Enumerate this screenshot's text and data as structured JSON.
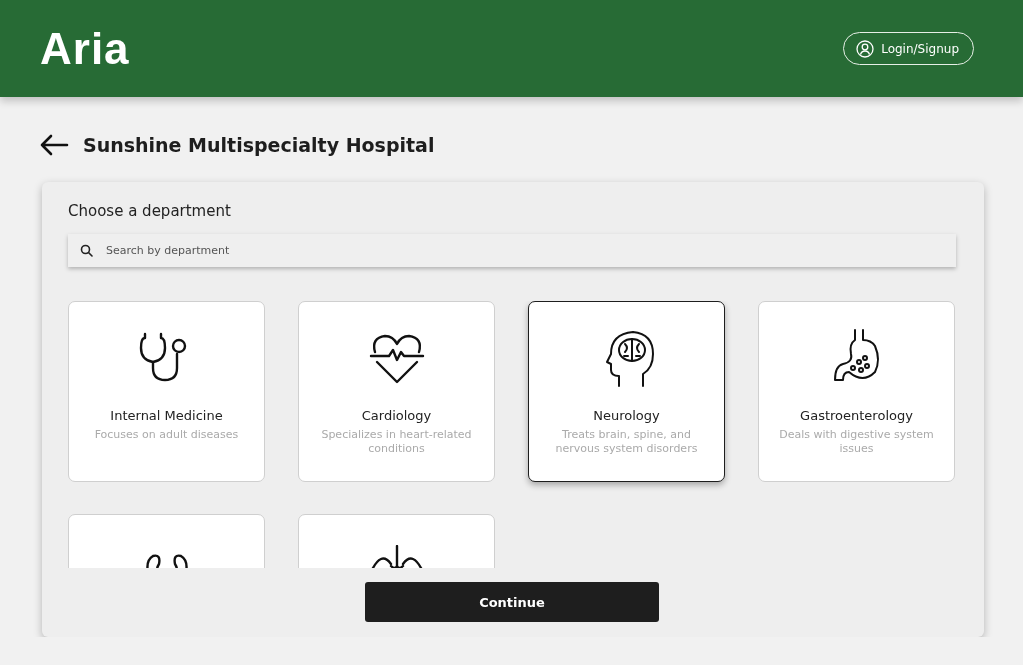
{
  "header": {
    "logo": "Aria",
    "login_button": "Login/Signup"
  },
  "page": {
    "title": "Sunshine Multispecialty Hospital"
  },
  "panel": {
    "heading": "Choose a department",
    "search": {
      "placeholder": "Search by department"
    },
    "departments": [
      {
        "kind": "stethoscope",
        "name": "Internal Medicine",
        "description": "Focuses on adult diseases",
        "selected": false
      },
      {
        "kind": "heart",
        "name": "Cardiology",
        "description": "Specializes in heart-related conditions",
        "selected": false
      },
      {
        "kind": "brain",
        "name": "Neurology",
        "description": "Treats brain, spine, and nervous system disorders",
        "selected": true
      },
      {
        "kind": "stomach",
        "name": "Gastroenterology",
        "description": "Deals with digestive system issues",
        "selected": false
      },
      {
        "kind": "kidneys",
        "selected": false
      },
      {
        "kind": "lungs",
        "selected": false
      }
    ],
    "continue_button": "Continue"
  }
}
